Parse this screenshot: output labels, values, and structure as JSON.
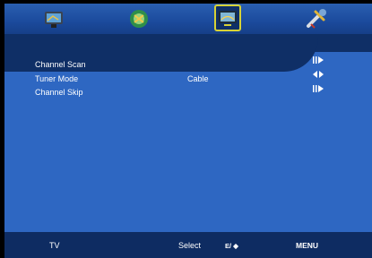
{
  "tabs": [
    {
      "name": "tv-icon"
    },
    {
      "name": "audio-icon"
    },
    {
      "name": "channel-icon"
    },
    {
      "name": "setup-icon"
    }
  ],
  "menu": {
    "items": [
      {
        "label": "Channel Scan",
        "value": ""
      },
      {
        "label": "Tuner Mode",
        "value": "Cable"
      },
      {
        "label": "Channel Skip",
        "value": ""
      }
    ]
  },
  "footer": {
    "source": "TV",
    "select_label": "Select",
    "keys_label": "E/ ◆",
    "menu_label": "MENU"
  },
  "colors": {
    "panel": "#2e67c2",
    "highlight": "#0f2f66",
    "bar": "#0e2c62",
    "text": "#ffffff"
  }
}
